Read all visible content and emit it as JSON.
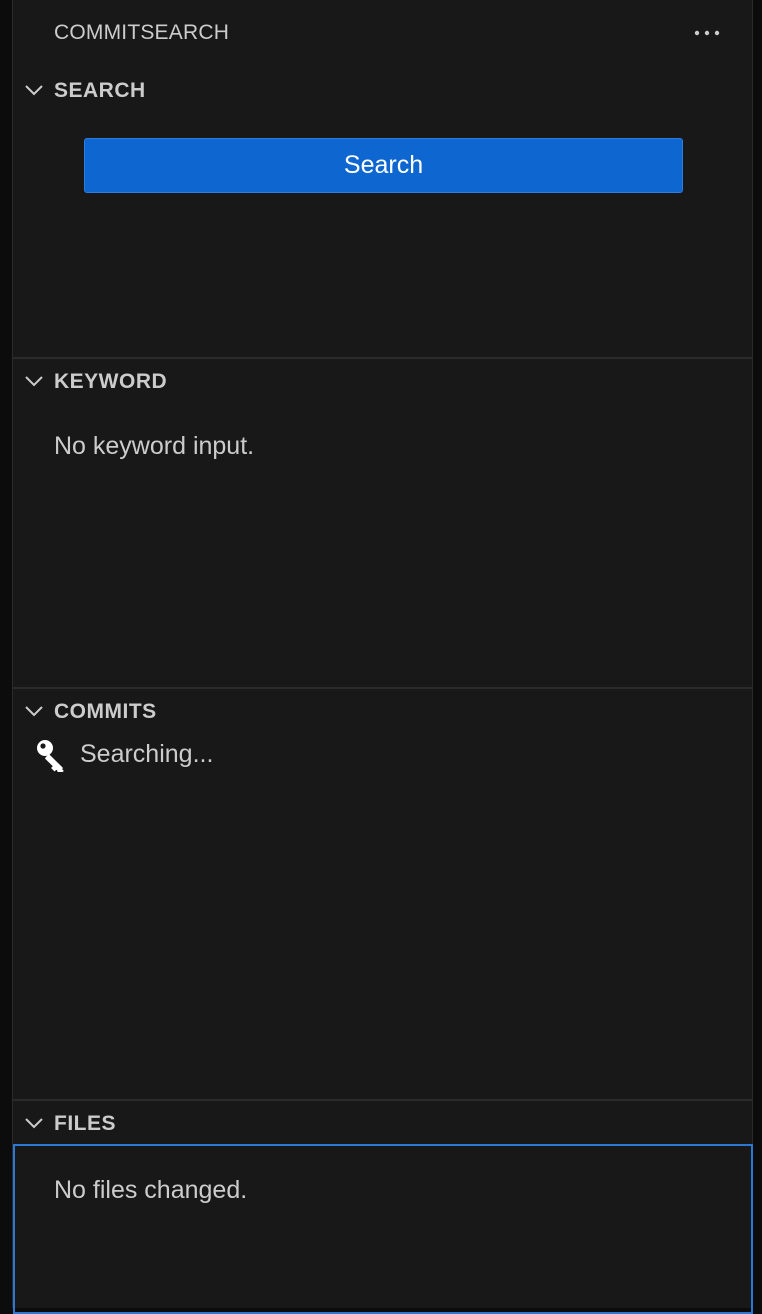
{
  "view": {
    "title": "COMMITSEARCH",
    "more_actions_icon": "ellipsis-icon"
  },
  "sections": {
    "search": {
      "title": "SEARCH",
      "button_label": "Search"
    },
    "keyword": {
      "title": "KEYWORD",
      "message": "No keyword input."
    },
    "commits": {
      "title": "COMMITS",
      "status_icon": "key-icon",
      "status_label": "Searching..."
    },
    "files": {
      "title": "FILES",
      "message": "No files changed."
    }
  },
  "colors": {
    "background": "#181818",
    "accent_button": "#0e66d0",
    "focus_border": "#2b79d4",
    "text": "#cccccc"
  }
}
